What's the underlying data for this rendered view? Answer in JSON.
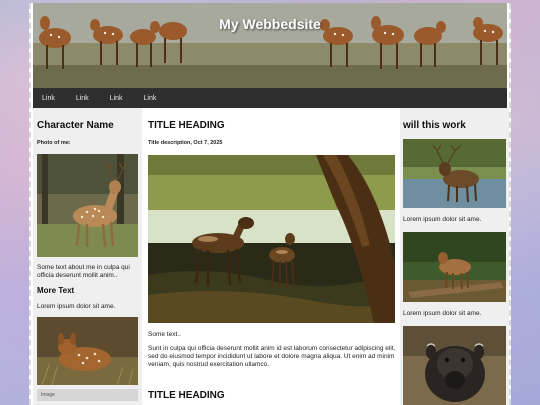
{
  "header": {
    "title": "My Webbedsite"
  },
  "nav": {
    "links": [
      "Link",
      "Link",
      "Link",
      "Link"
    ]
  },
  "left": {
    "heading": "Character Name",
    "photo_caption": "Photo of me:",
    "about_text": "Some text about me in culpa qui officia deserunt mollit anim..",
    "more_heading": "More Text",
    "more_text": "Lorem ipsum dolor sit ame.",
    "footer_text": "Image"
  },
  "main": {
    "title1": "TITLE HEADING",
    "description": "Title description, Oct 7, 2025",
    "some_text": "Some text..",
    "body_text": "Sunt in culpa qui officia deserunt mollit anim id est laborum consectetur adipiscing elit, sed do eiusmod tempor incididunt ut labore et dolore magna aliqua. Ut enim ad minim veniam, quis nostrud exercitation ullamco.",
    "title2": "TITLE HEADING"
  },
  "right": {
    "heading": "will this work",
    "captions": [
      "Lorem ipsum dolor sit ame.",
      "Lorem ipsum dolor sit ame."
    ]
  }
}
